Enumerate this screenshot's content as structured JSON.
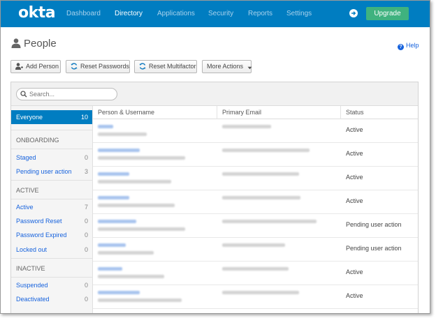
{
  "nav": {
    "logo": "okta",
    "items": [
      {
        "label": "Dashboard",
        "active": false
      },
      {
        "label": "Directory",
        "active": true
      },
      {
        "label": "Applications",
        "active": false
      },
      {
        "label": "Security",
        "active": false
      },
      {
        "label": "Reports",
        "active": false
      },
      {
        "label": "Settings",
        "active": false
      }
    ],
    "upgrade_label": "Upgrade",
    "brand_color": "#007dc1",
    "upgrade_color": "#3fb27f"
  },
  "page": {
    "title": "People",
    "title_icon": "person-icon",
    "help_label": "Help"
  },
  "toolbar": {
    "add_person": "Add Person",
    "reset_passwords": "Reset Passwords",
    "reset_multifactor": "Reset Multifactor",
    "more_actions": "More Actions"
  },
  "search": {
    "placeholder": "Search..."
  },
  "sidebar": {
    "everyone": {
      "label": "Everyone",
      "count": "10"
    },
    "sections": [
      {
        "header": "ONBOARDING",
        "items": [
          {
            "label": "Staged",
            "count": "0"
          },
          {
            "label": "Pending user action",
            "count": "3"
          }
        ]
      },
      {
        "header": "ACTIVE",
        "items": [
          {
            "label": "Active",
            "count": "7"
          },
          {
            "label": "Password Reset",
            "count": "0"
          },
          {
            "label": "Password Expired",
            "count": "0"
          },
          {
            "label": "Locked out",
            "count": "0"
          }
        ]
      },
      {
        "header": "INACTIVE",
        "items": [
          {
            "label": "Suspended",
            "count": "0"
          },
          {
            "label": "Deactivated",
            "count": "0"
          }
        ]
      }
    ]
  },
  "table": {
    "columns": [
      "Person & Username",
      "Primary Email",
      "Status"
    ],
    "rows": [
      {
        "status": "Active"
      },
      {
        "status": "Active"
      },
      {
        "status": "Active"
      },
      {
        "status": "Active"
      },
      {
        "status": "Pending user action"
      },
      {
        "status": "Pending user action"
      },
      {
        "status": "Active"
      },
      {
        "status": "Active"
      }
    ]
  }
}
